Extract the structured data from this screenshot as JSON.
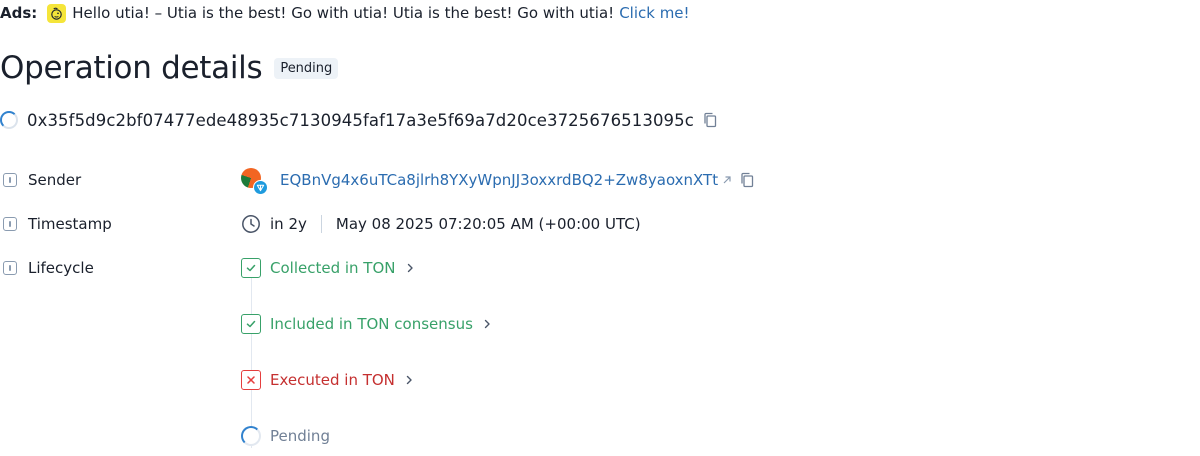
{
  "ads": {
    "label": "Ads:",
    "logo_icon": "duck-logo-icon",
    "text": "Hello utia! – Utia is the best! Go with utia! Utia is the best! Go with utia!",
    "link_label": "Click me!"
  },
  "header": {
    "title": "Operation details",
    "status": "Pending"
  },
  "operation": {
    "hash": "0x35f5d9c2bf07477ede48935c7130945faf17a3e5f69a7d20ce3725676513095c",
    "status_icon": "loading-spinner-icon",
    "copy_icon": "copy-icon"
  },
  "details": {
    "sender": {
      "label": "Sender",
      "address": "EQBnVg4x6uTCa8jlrh8YXyWpnJJ3oxxrdBQ2+Zw8yaoxnXTt",
      "avatar_icon": "ton-token-avatar-icon"
    },
    "timestamp": {
      "label": "Timestamp",
      "relative": "in 2y",
      "absolute": "May 08 2025 07:20:05 AM (+00:00 UTC)"
    },
    "lifecycle": {
      "label": "Lifecycle",
      "steps": [
        {
          "label": "Collected in TON",
          "status": "success"
        },
        {
          "label": "Included in TON consensus",
          "status": "success"
        },
        {
          "label": "Executed in TON",
          "status": "failed"
        },
        {
          "label": "Pending",
          "status": "pending"
        }
      ]
    }
  },
  "colors": {
    "link": "#2b6cb0",
    "success": "#38a169",
    "error": "#c53030",
    "pending": "#718096",
    "ads_logo_bg": "#f5e53a"
  }
}
